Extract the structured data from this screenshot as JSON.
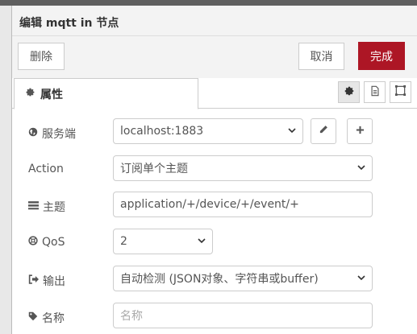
{
  "header": {
    "title": "编辑 mqtt in 节点"
  },
  "toolbar": {
    "delete_label": "删除",
    "cancel_label": "取消",
    "done_label": "完成"
  },
  "tabs": [
    {
      "label": "属性",
      "icon": "gear-icon"
    }
  ],
  "tab_icons": [
    "gear-icon",
    "document-icon",
    "frame-icon"
  ],
  "form": {
    "server": {
      "label": "服务端",
      "icon": "globe-icon",
      "value": "localhost:1883"
    },
    "action": {
      "label": "Action",
      "value": "订阅单个主题"
    },
    "topic": {
      "label": "主题",
      "icon": "tasks-icon",
      "value": "application/+/device/+/event/+"
    },
    "qos": {
      "label": "QoS",
      "icon": "life-ring-icon",
      "value": "2"
    },
    "output": {
      "label": "输出",
      "icon": "sign-out-icon",
      "value": "自动检测 (JSON对象、字符串或buffer)"
    },
    "name": {
      "label": "名称",
      "icon": "tag-icon",
      "placeholder": "名称"
    }
  },
  "colors": {
    "primary": "#ad1625",
    "border": "#cccccc",
    "header_bg": "#f3f3f3"
  }
}
